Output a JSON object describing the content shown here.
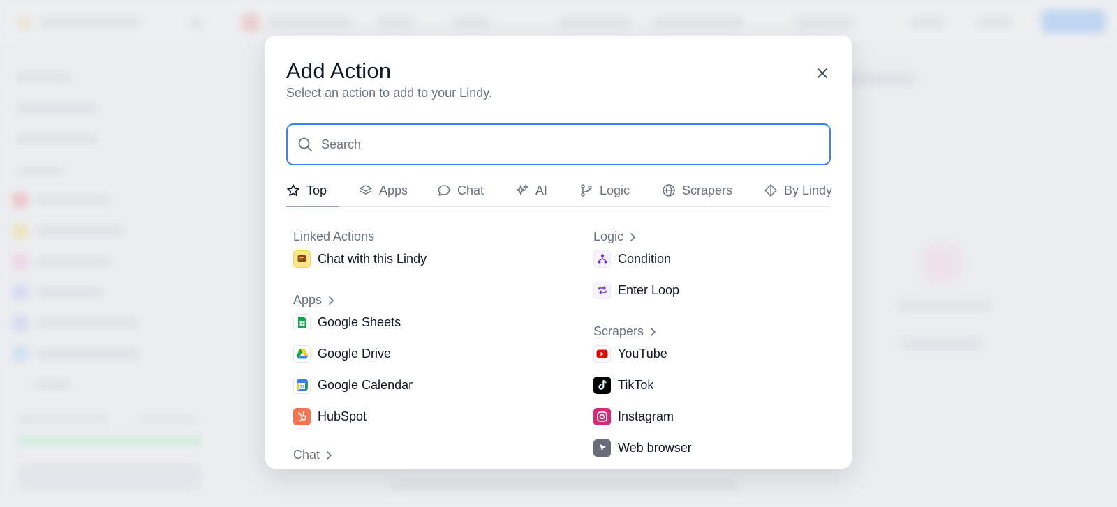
{
  "modal": {
    "title": "Add Action",
    "subtitle": "Select an action to add to your Lindy.",
    "close_icon": "close-icon"
  },
  "search": {
    "placeholder": "Search",
    "value": "",
    "icon": "search-icon"
  },
  "tabs": [
    {
      "label": "Top",
      "icon": "star-icon",
      "active": true
    },
    {
      "label": "Apps",
      "icon": "layers-icon",
      "active": false
    },
    {
      "label": "Chat",
      "icon": "chat-bubble-icon",
      "active": false
    },
    {
      "label": "AI",
      "icon": "sparkles-icon",
      "active": false
    },
    {
      "label": "Logic",
      "icon": "git-branch-icon",
      "active": false
    },
    {
      "label": "Scrapers",
      "icon": "globe-icon",
      "active": false
    },
    {
      "label": "By Lindy",
      "icon": "lindy-diamond-icon",
      "active": false
    }
  ],
  "sections": {
    "linked_actions": {
      "title": "Linked Actions",
      "items": [
        {
          "label": "Chat with this Lindy",
          "icon": "lindy-chat-icon"
        }
      ]
    },
    "apps": {
      "title": "Apps",
      "items": [
        {
          "label": "Google Sheets",
          "icon": "google-sheets-icon"
        },
        {
          "label": "Google Drive",
          "icon": "google-drive-icon"
        },
        {
          "label": "Google Calendar",
          "icon": "google-calendar-icon"
        },
        {
          "label": "HubSpot",
          "icon": "hubspot-icon"
        }
      ]
    },
    "chat": {
      "title": "Chat"
    },
    "logic": {
      "title": "Logic",
      "items": [
        {
          "label": "Condition",
          "icon": "condition-icon"
        },
        {
          "label": "Enter Loop",
          "icon": "loop-icon"
        }
      ]
    },
    "scrapers": {
      "title": "Scrapers",
      "items": [
        {
          "label": "YouTube",
          "icon": "youtube-icon"
        },
        {
          "label": "TikTok",
          "icon": "tiktok-icon"
        },
        {
          "label": "Instagram",
          "icon": "instagram-icon"
        },
        {
          "label": "Web browser",
          "icon": "web-browser-icon"
        }
      ]
    }
  },
  "colors": {
    "accent": "#3b82f6",
    "text_primary": "#111827",
    "text_muted": "#6b7280"
  }
}
